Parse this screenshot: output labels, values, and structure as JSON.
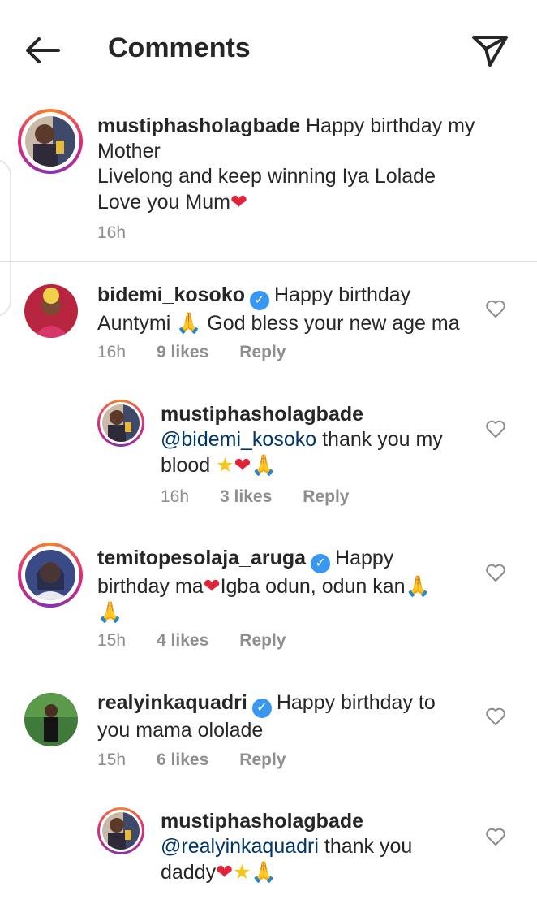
{
  "header": {
    "title": "Comments"
  },
  "caption": {
    "username": "mustiphasholagbade",
    "lines": [
      "Happy birthday my",
      "Mother",
      "Livelong and keep winning Iya Lolade",
      "Love you Mum"
    ],
    "time": "16h"
  },
  "comments": [
    {
      "username": "bidemi_kosoko",
      "text_1": "Happy birthday",
      "text_2": "Auntymi",
      "text_3": "God bless your new age ma",
      "time": "16h",
      "likes": "9 likes",
      "reply": "Reply"
    },
    {
      "username": "mustiphasholagbade",
      "mention": "@bidemi_kosoko",
      "text_1": "thank you my",
      "text_2": "blood",
      "time": "16h",
      "likes": "3 likes",
      "reply": "Reply"
    },
    {
      "username": "temitopesolaja_aruga",
      "text_1": "Happy",
      "text_2": "birthday ma",
      "text_3": "Igba odun, odun kan",
      "time": "15h",
      "likes": "4 likes",
      "reply": "Reply"
    },
    {
      "username": "realyinkaquadri",
      "text_1": "Happy birthday to",
      "text_2": "you mama ololade",
      "time": "15h",
      "likes": "6 likes",
      "reply": "Reply"
    },
    {
      "username": "mustiphasholagbade",
      "mention": "@realyinkaquadri",
      "text_1": "thank you",
      "text_2": "daddy"
    }
  ],
  "icons": {
    "back": "arrow-left-icon",
    "share": "paper-plane-icon",
    "like": "heart-outline-icon",
    "verified": "verified-badge-icon"
  },
  "colors": {
    "verified": "#3897f0",
    "mention": "#00376b",
    "meta": "#8e8e8e"
  }
}
